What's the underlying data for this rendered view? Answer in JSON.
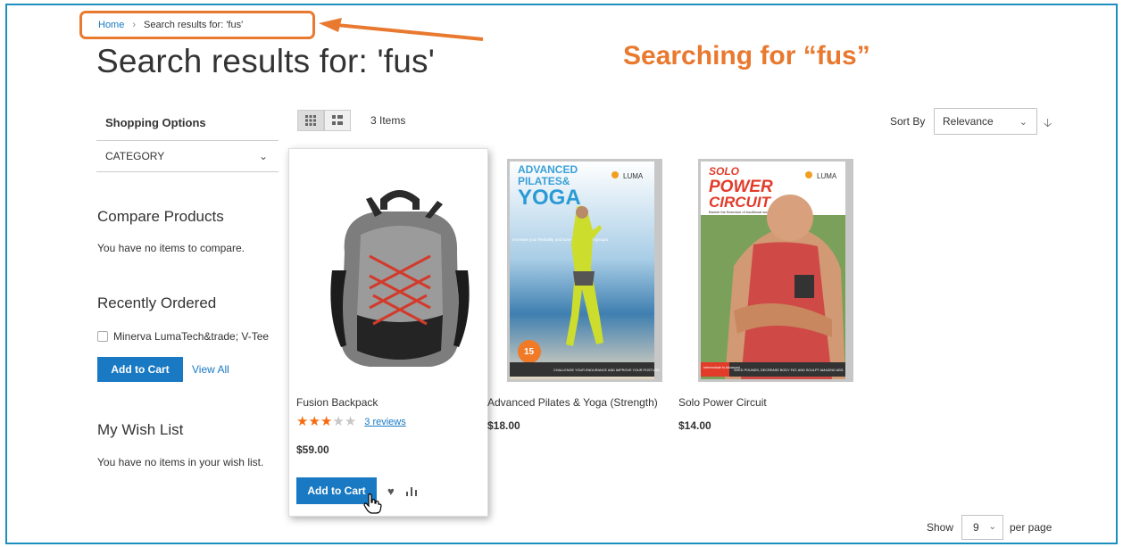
{
  "breadcrumb": {
    "home": "Home",
    "separator": "›",
    "current": "Search results for: 'fus'"
  },
  "page_title": "Search results for: 'fus'",
  "annotation": "Searching for “fus”",
  "sidebar": {
    "shopping_options": "Shopping Options",
    "category_label": "CATEGORY",
    "compare_title": "Compare Products",
    "compare_empty": "You have no items to compare.",
    "recently_ordered_title": "Recently Ordered",
    "recent_item": "Minerva LumaTech&trade; V-Tee",
    "add_to_cart": "Add to Cart",
    "view_all": "View All",
    "wishlist_title": "My Wish List",
    "wishlist_empty": "You have no items in your wish list."
  },
  "toolbar": {
    "items_count": "3 Items",
    "sort_label": "Sort By",
    "sort_value": "Relevance",
    "show_label": "Show",
    "limit_value": "9",
    "per_page_label": "per page"
  },
  "products": [
    {
      "name": "Fusion Backpack",
      "price": "$59.00",
      "rating_stars": 3,
      "rating_max": 5,
      "reviews": "3 reviews",
      "add_to_cart": "Add to Cart"
    },
    {
      "name": "Advanced Pilates & Yoga (Strength)",
      "price": "$18.00",
      "cover": {
        "title1": "ADVANCED",
        "title2": "PILATES&",
        "title3": "YOGA",
        "brand": "LUMA",
        "blurb": "Increase your flexibility and tone core muscle groups",
        "badge": "15",
        "footer": "CHALLENGE YOUR ENDURANCE AND IMPROVE YOUR POSTURE."
      }
    },
    {
      "name": "Solo Power Circuit",
      "price": "$14.00",
      "cover": {
        "title1": "SOLO",
        "title2": "POWER",
        "title3": "CIRCUIT",
        "brand": "LUMA",
        "blurb": "Banish the Boredom of traditional workouts",
        "level": "Intermediate to Advanced",
        "footer": "SHED POUNDS, DECREASE BODY FAT, AND SCULPT AMAZING ABS."
      }
    }
  ],
  "colors": {
    "accent": "#1979c3",
    "annotation": "#e8792f",
    "frame": "#1c8fbf",
    "star": "#f76b0e"
  },
  "icons": [
    "chevron-down-icon",
    "grid-view-icon",
    "list-view-icon",
    "sort-arrow-icon",
    "heart-icon",
    "compare-icon",
    "hand-cursor-icon",
    "arrow-icon"
  ]
}
